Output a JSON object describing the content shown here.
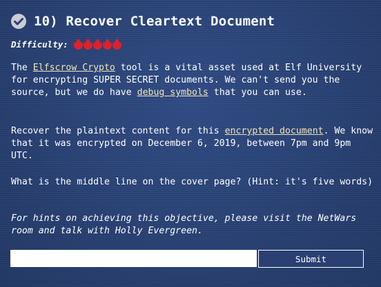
{
  "objective": {
    "number_title": "10) Recover Cleartext Document",
    "completed_icon": "check-circle-icon"
  },
  "difficulty": {
    "label": "Difficulty:",
    "level": 5,
    "max": 5,
    "icon": "difficulty-flame-icon",
    "color": "#e0202a"
  },
  "description": {
    "p1_before_link1": "The ",
    "link1": "Elfscrow Crypto",
    "p1_mid": " tool is a vital asset used at Elf University for encrypting SUPER SECRET documents. We can't send you the source, but we do have ",
    "link2": "debug symbols",
    "p1_after": " that you can use.",
    "p2_before_link": "Recover the plaintext content for this ",
    "link3": "encrypted document",
    "p2_after": ". We know that it was encrypted on December 6, 2019, between 7pm and 9pm UTC.",
    "p3": "What is the middle line on the cover page? (Hint: it's five words)",
    "p4": "For hints on achieving this objective, please visit the NetWars room and talk with Holly Evergreen."
  },
  "form": {
    "answer_value": "",
    "answer_placeholder": "",
    "submit_label": "Submit"
  },
  "colors": {
    "background": "#2a4072",
    "link": "#f2e6b8",
    "text": "#ffffff"
  }
}
